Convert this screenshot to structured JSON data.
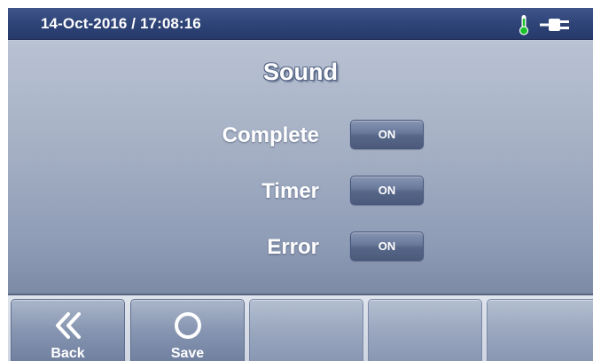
{
  "status_bar": {
    "datetime": "14-Oct-2016 / 17:08:16",
    "icons": [
      "thermometer-icon",
      "power-plug-icon"
    ],
    "thermometer_color": "#19c12a"
  },
  "screen": {
    "title": "Sound",
    "settings": [
      {
        "label": "Complete",
        "value": "ON"
      },
      {
        "label": "Timer",
        "value": "ON"
      },
      {
        "label": "Error",
        "value": "ON"
      }
    ]
  },
  "nav": {
    "back_label": "Back",
    "back_icon": "double-chevron-left-icon",
    "save_label": "Save",
    "save_icon": "circle-icon"
  },
  "colors": {
    "status_bar": "#2f4477",
    "background": "#a6b1c5",
    "toggle": "#5d6d8f"
  }
}
